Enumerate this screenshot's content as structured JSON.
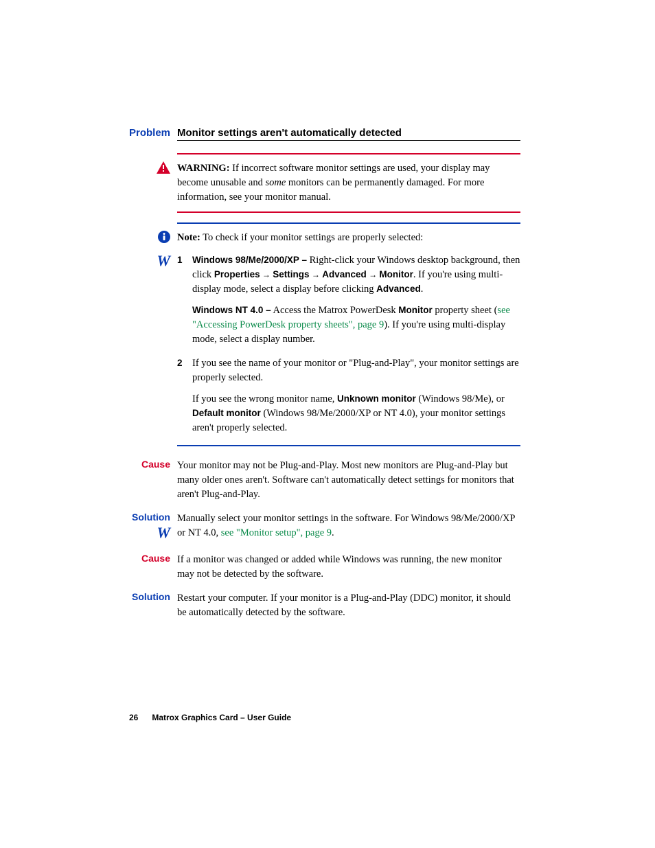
{
  "heading": {
    "label": "Problem",
    "title": "Monitor settings aren't automatically detected"
  },
  "warning": {
    "prefix": "WARNING:",
    "text1": " If incorrect software monitor settings are used, your display may become unusable and ",
    "em": "some",
    "text2": " monitors can be permanently damaged. For more information, see your monitor manual."
  },
  "note": {
    "prefix": "Note:",
    "text": " To check if your monitor settings are properly selected:"
  },
  "steps": {
    "s1": {
      "num": "1",
      "os1": "Windows 98/Me/2000/XP –",
      "t1a": " Right-click your Windows desktop background, then click ",
      "p1": "Properties",
      "arr": " → ",
      "p2": "Settings",
      "p3": "Advanced",
      "p4": "Monitor",
      "t1b": ". If you're using multi-display mode, select a display before clicking ",
      "p5": "Advanced",
      "t1c": ".",
      "os2": "Windows NT 4.0 –",
      "t2a": " Access the Matrox PowerDesk ",
      "p6": "Monitor",
      "t2b": " property sheet (",
      "link1": "see \"Accessing PowerDesk property sheets\", page 9",
      "t2c": "). If you're using multi-display mode, select a display number."
    },
    "s2": {
      "num": "2",
      "t1": "If you see the name of your monitor or \"Plug-and-Play\", your monitor settings are properly selected.",
      "t2a": "If you see the wrong monitor name, ",
      "b1": "Unknown monitor",
      "t2b": " (Windows 98/Me), or ",
      "b2": "Default monitor",
      "t2c": " (Windows 98/Me/2000/XP or NT 4.0), your monitor settings aren't properly selected."
    }
  },
  "cause1": {
    "label": "Cause",
    "text": "Your monitor may not be Plug-and-Play. Most new monitors are Plug-and-Play but many older ones aren't. Software can't automatically detect settings for monitors that aren't Plug-and-Play."
  },
  "solution1": {
    "label": "Solution",
    "t1": "Manually select your monitor settings in the software. For Windows 98/Me/2000/XP or NT 4.0, ",
    "link": "see \"Monitor setup\", page 9",
    "t2": "."
  },
  "cause2": {
    "label": "Cause",
    "text": "If a monitor was changed or added while Windows was running, the new monitor may not be detected by the software."
  },
  "solution2": {
    "label": "Solution",
    "text": "Restart your computer. If your monitor is a Plug-and-Play (DDC) monitor, it should be automatically detected by the software."
  },
  "footer": {
    "page": "26",
    "title": "Matrox Graphics Card – User Guide"
  }
}
